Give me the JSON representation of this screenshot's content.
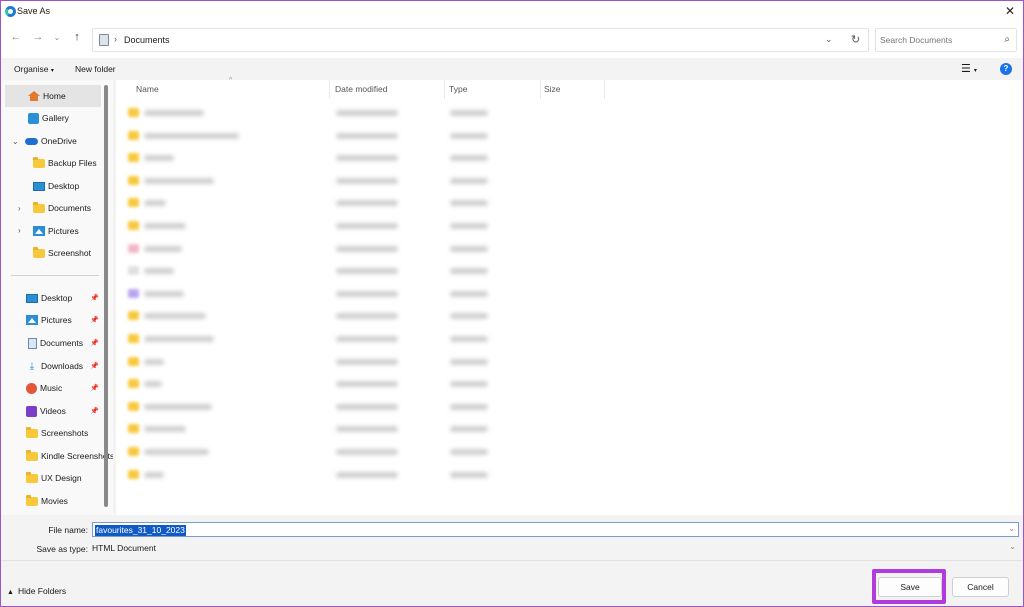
{
  "window": {
    "title": "Save As"
  },
  "address": {
    "crumb": "Documents"
  },
  "search": {
    "placeholder": "Search Documents"
  },
  "commands": {
    "organise": "Organise",
    "new_folder": "New folder"
  },
  "sidebar": {
    "top": [
      {
        "label": "Home",
        "icon": "home-icon"
      },
      {
        "label": "Gallery",
        "icon": "gallery-icon"
      },
      {
        "label": "OneDrive",
        "icon": "cloud-icon"
      },
      {
        "label": "Backup Files",
        "icon": "folder-icon"
      },
      {
        "label": "Desktop",
        "icon": "desktop-icon"
      },
      {
        "label": "Documents",
        "icon": "folder-icon"
      },
      {
        "label": "Pictures",
        "icon": "pictures-icon"
      },
      {
        "label": "Screenshot",
        "icon": "folder-icon"
      }
    ],
    "quick": [
      {
        "label": "Desktop",
        "icon": "desktop-icon"
      },
      {
        "label": "Pictures",
        "icon": "pictures-icon"
      },
      {
        "label": "Documents",
        "icon": "documents-icon"
      },
      {
        "label": "Downloads",
        "icon": "download-icon"
      },
      {
        "label": "Music",
        "icon": "music-icon"
      },
      {
        "label": "Videos",
        "icon": "video-icon"
      },
      {
        "label": "Screenshots",
        "icon": "folder-icon"
      },
      {
        "label": "Kindle Screenshots",
        "icon": "folder-icon"
      },
      {
        "label": "UX Design",
        "icon": "folder-icon"
      },
      {
        "label": "Movies",
        "icon": "folder-icon"
      }
    ]
  },
  "columns": {
    "name": "Name",
    "date": "Date modified",
    "type": "Type",
    "size": "Size"
  },
  "form": {
    "file_name_label": "File name:",
    "file_name_value": "favourites_31_10_2023",
    "save_type_label": "Save as type:",
    "save_type_value": "HTML Document"
  },
  "footer": {
    "hide_folders": "Hide Folders",
    "save": "Save",
    "cancel": "Cancel"
  },
  "colors": {
    "accent": "#b13bdc",
    "selection": "#0f5ac7",
    "folder": "#f8c83c"
  }
}
